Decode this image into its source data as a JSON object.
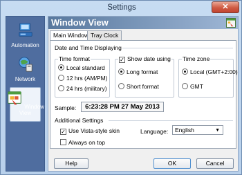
{
  "window": {
    "title": "Settings",
    "close_glyph": "✕"
  },
  "sidebar": {
    "items": [
      {
        "label": "Automation",
        "icon": "automation-icon"
      },
      {
        "label": "Network",
        "icon": "network-icon"
      },
      {
        "label": "Window View",
        "icon": "window-view-icon",
        "active": true
      }
    ]
  },
  "main": {
    "header_title": "Window View",
    "tabs": [
      {
        "label": "Main Window",
        "active": true
      },
      {
        "label": "Tray Clock"
      }
    ],
    "date_time_section": "Date and Time Displaying",
    "time_format": {
      "title": "Time format",
      "options": [
        "Local standard",
        "12 hrs (AM/PM)",
        "24 hrs (military)"
      ],
      "selected": 0
    },
    "date_format": {
      "title": "Show date using",
      "checked": true,
      "options": [
        "Long format",
        "Short format"
      ],
      "selected": 0
    },
    "time_zone": {
      "title": "Time zone",
      "options": [
        "Local (GMT+2:00)",
        "GMT"
      ],
      "selected": 0
    },
    "sample_label": "Sample:",
    "sample_value": "6:23:28 PM   27 May 2013",
    "additional_section": "Additional Settings",
    "vista_skin": {
      "label": "Use Vista-style skin",
      "checked": true
    },
    "always_on_top": {
      "label": "Always on top",
      "checked": false
    },
    "language": {
      "label": "Language:",
      "value": "English"
    }
  },
  "footer": {
    "help": "Help",
    "ok": "OK",
    "cancel": "Cancel"
  }
}
